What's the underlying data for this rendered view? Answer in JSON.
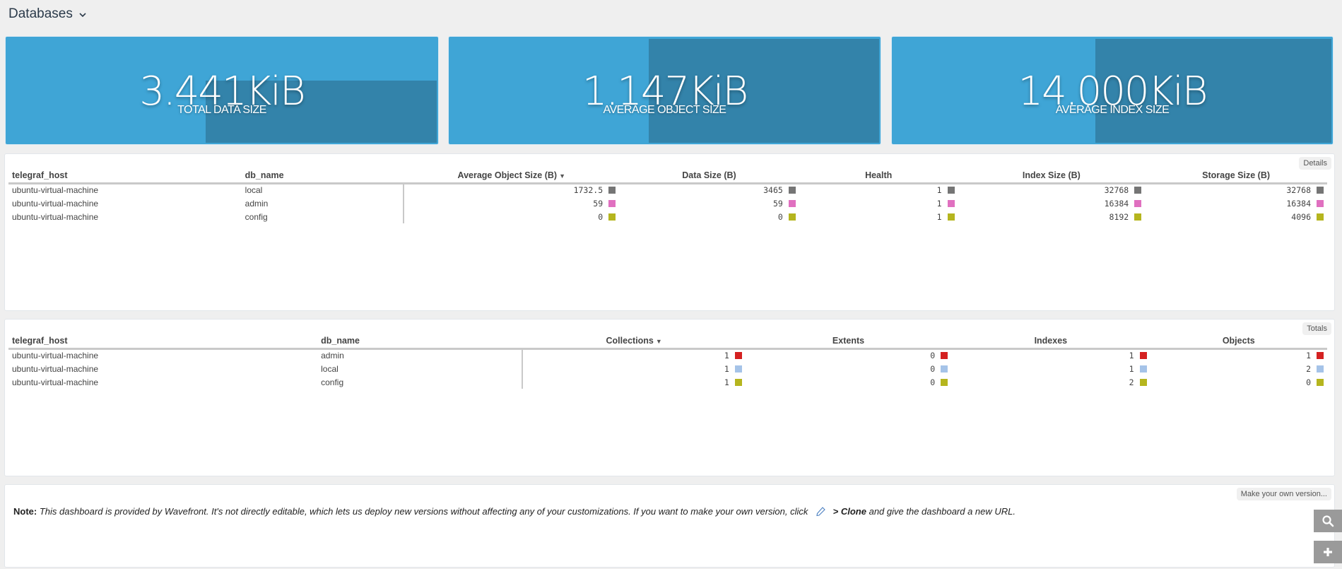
{
  "header": {
    "title": "Databases",
    "dropdown_icon": "chevron-down-icon"
  },
  "kpis": [
    {
      "value": "3.441KiB",
      "label": "TOTAL DATA SIZE"
    },
    {
      "value": "1.147KiB",
      "label": "AVERAGE OBJECT SIZE"
    },
    {
      "value": "14.000KiB",
      "label": "AVERAGE INDEX SIZE"
    }
  ],
  "colors": {
    "kpi_bg": "#3fa5d6",
    "kpi_shade": "#3383aa",
    "gray": "#757575",
    "pink": "#e070c0",
    "olive": "#b5b51e",
    "red": "#d42121",
    "lightblue": "#a5c3e8"
  },
  "details": {
    "button": "Details",
    "columns": [
      "telegraf_host",
      "db_name",
      "Average Object Size (B)",
      "Data Size (B)",
      "Health",
      "Index Size (B)",
      "Storage Size (B)"
    ],
    "sorted_column": "Average Object Size (B)",
    "rows": [
      {
        "host": "ubuntu-virtual-machine",
        "db": "local",
        "avg_obj": "1732.5",
        "data": "3465",
        "health": "1",
        "index": "32768",
        "storage": "32768",
        "color": "#757575"
      },
      {
        "host": "ubuntu-virtual-machine",
        "db": "admin",
        "avg_obj": "59",
        "data": "59",
        "health": "1",
        "index": "16384",
        "storage": "16384",
        "color": "#e070c0"
      },
      {
        "host": "ubuntu-virtual-machine",
        "db": "config",
        "avg_obj": "0",
        "data": "0",
        "health": "1",
        "index": "8192",
        "storage": "4096",
        "color": "#b5b51e"
      }
    ]
  },
  "totals": {
    "button": "Totals",
    "columns": [
      "telegraf_host",
      "db_name",
      "Collections",
      "Extents",
      "Indexes",
      "Objects"
    ],
    "sorted_column": "Collections",
    "rows": [
      {
        "host": "ubuntu-virtual-machine",
        "db": "admin",
        "collections": "1",
        "extents": "0",
        "indexes": "1",
        "objects": "1",
        "color": "#d42121"
      },
      {
        "host": "ubuntu-virtual-machine",
        "db": "local",
        "collections": "1",
        "extents": "0",
        "indexes": "1",
        "objects": "2",
        "color": "#a5c3e8"
      },
      {
        "host": "ubuntu-virtual-machine",
        "db": "config",
        "collections": "1",
        "extents": "0",
        "indexes": "2",
        "objects": "0",
        "color": "#b5b51e"
      }
    ]
  },
  "note": {
    "button": "Make your own version...",
    "label": "Note:",
    "text_before": "This dashboard is provided by Wavefront. It's not directly editable, which lets us deploy new versions without affecting any of your customizations. If you want to make your own version, click",
    "clone": "> Clone",
    "text_after": "and give the dashboard a new URL."
  },
  "floating": {
    "search_icon": "search-icon",
    "add_icon": "plus-icon"
  }
}
